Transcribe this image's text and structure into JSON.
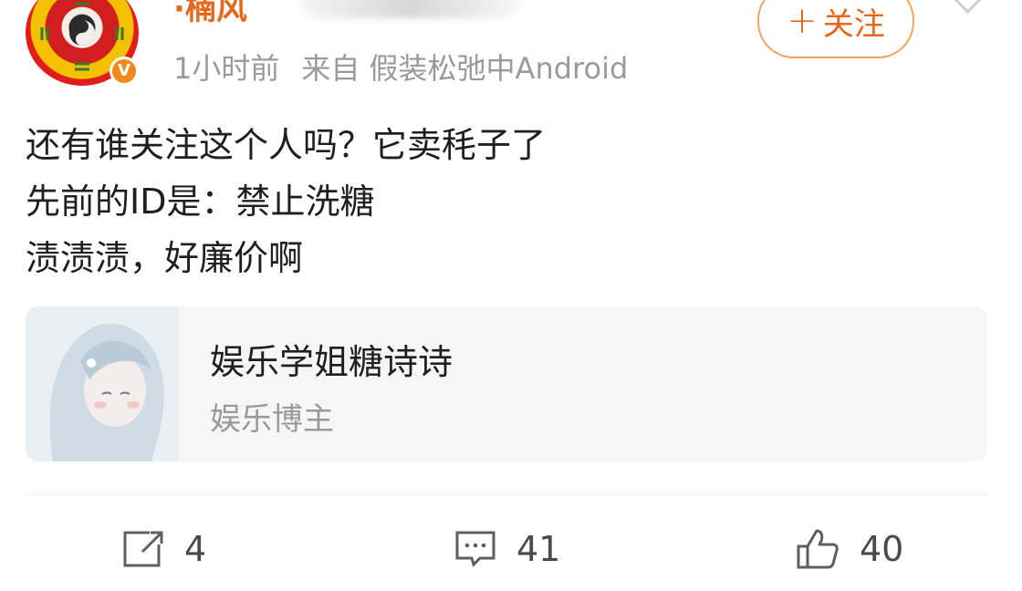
{
  "post": {
    "author": "·楠风",
    "time": "1小时前",
    "source": "来自 假装松弛中Android",
    "follow_label": "关注",
    "follow_plus": "+",
    "verified_mark": "V",
    "lines": [
      "还有谁关注这个人吗？它卖秏子了",
      "先前的ID是：禁止洗糖",
      "渍渍渍，好廉价啊"
    ]
  },
  "card": {
    "title": "娱乐学姐糖诗诗",
    "subtitle": "娱乐博主"
  },
  "actions": {
    "repost_count": "4",
    "comment_count": "41",
    "like_count": "40"
  },
  "colors": {
    "accent": "#e8671b",
    "meta": "#9a9a9a",
    "text": "#1f1f1f"
  }
}
